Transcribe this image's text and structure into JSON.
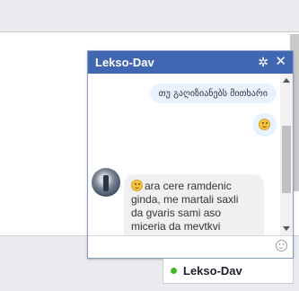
{
  "chat": {
    "title": "Lekso-Dav",
    "icons": {
      "settings": "gear-icon",
      "close": "close-icon",
      "emoji_picker": "smile-icon"
    },
    "messages": [
      {
        "from": "me",
        "text": "თუ გაღიზიანებს მითხარი"
      },
      {
        "from": "me",
        "emoji": "smile-emoji"
      },
      {
        "from": "Lekso-Dav",
        "emoji": "smile-emoji",
        "text": "ara cere ramdenic\nginda, me martali saxli\nda gvaris sami aso\nmiceria da mevtkvi\nmicno vigacam"
      }
    ],
    "composer": {
      "value": "",
      "placeholder": ""
    }
  },
  "tab": {
    "label": "Lekso-Dav",
    "status": "online",
    "status_color": "#42b72a"
  },
  "colors": {
    "header": "#4267b2",
    "outgoing_bubble": "#e6f2fd",
    "incoming_bubble": "#f1f0f0"
  }
}
